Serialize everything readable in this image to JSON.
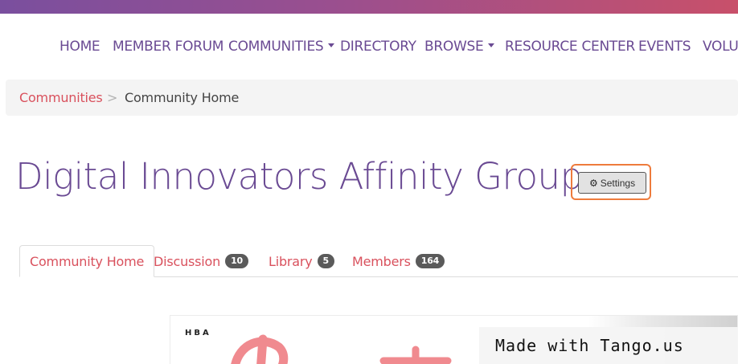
{
  "nav": {
    "items": [
      {
        "label": "HOME"
      },
      {
        "label": "MEMBER FORUM"
      },
      {
        "label": "COMMUNITIES"
      },
      {
        "label": "DIRECTORY"
      },
      {
        "label": "BROWSE"
      },
      {
        "label": "RESOURCE CENTER"
      },
      {
        "label": "EVENTS"
      },
      {
        "label": "VOLUN"
      }
    ]
  },
  "breadcrumb": {
    "link": "Communities",
    "separator": ">",
    "current": "Community Home"
  },
  "page": {
    "title": "Digital Innovators Affinity Group",
    "settings_label": "Settings"
  },
  "tabs": [
    {
      "label": "Community Home",
      "active": true
    },
    {
      "label": "Discussion",
      "count": "10"
    },
    {
      "label": "Library",
      "count": "5"
    },
    {
      "label": "Members",
      "count": "164"
    }
  ],
  "content": {
    "logo_text": "HBA"
  },
  "watermark": "Made with Tango.us",
  "colors": {
    "brand_purple": "#6a4a93",
    "link_red": "#d9515d",
    "highlight_orange": "#ee7b3c"
  }
}
